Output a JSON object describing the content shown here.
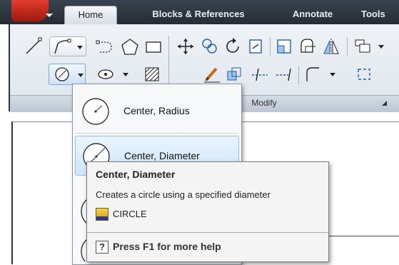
{
  "tabs": [
    {
      "label": "Home",
      "active": true
    },
    {
      "label": "Blocks & References",
      "active": false
    },
    {
      "label": "Annotate",
      "active": false
    },
    {
      "label": "Tools",
      "active": false
    }
  ],
  "ribbon": {
    "modify_panel_label": "Modify"
  },
  "circle_menu": {
    "items": [
      {
        "label": "Center, Radius",
        "icon": "circle-center-radius-icon",
        "highlighted": false
      },
      {
        "label": "Center, Diameter",
        "icon": "circle-center-diameter-icon",
        "highlighted": true
      }
    ]
  },
  "tooltip": {
    "title": "Center, Diameter",
    "description": "Creates a circle using a specified diameter",
    "command": "CIRCLE",
    "help_key": "?",
    "help_text": "Press F1 for more help"
  },
  "colors": {
    "tabbar": "#2f3640",
    "ribbon": "#e5eaf0",
    "highlight": "#cfe6f9",
    "app_button": "#c8281a"
  }
}
